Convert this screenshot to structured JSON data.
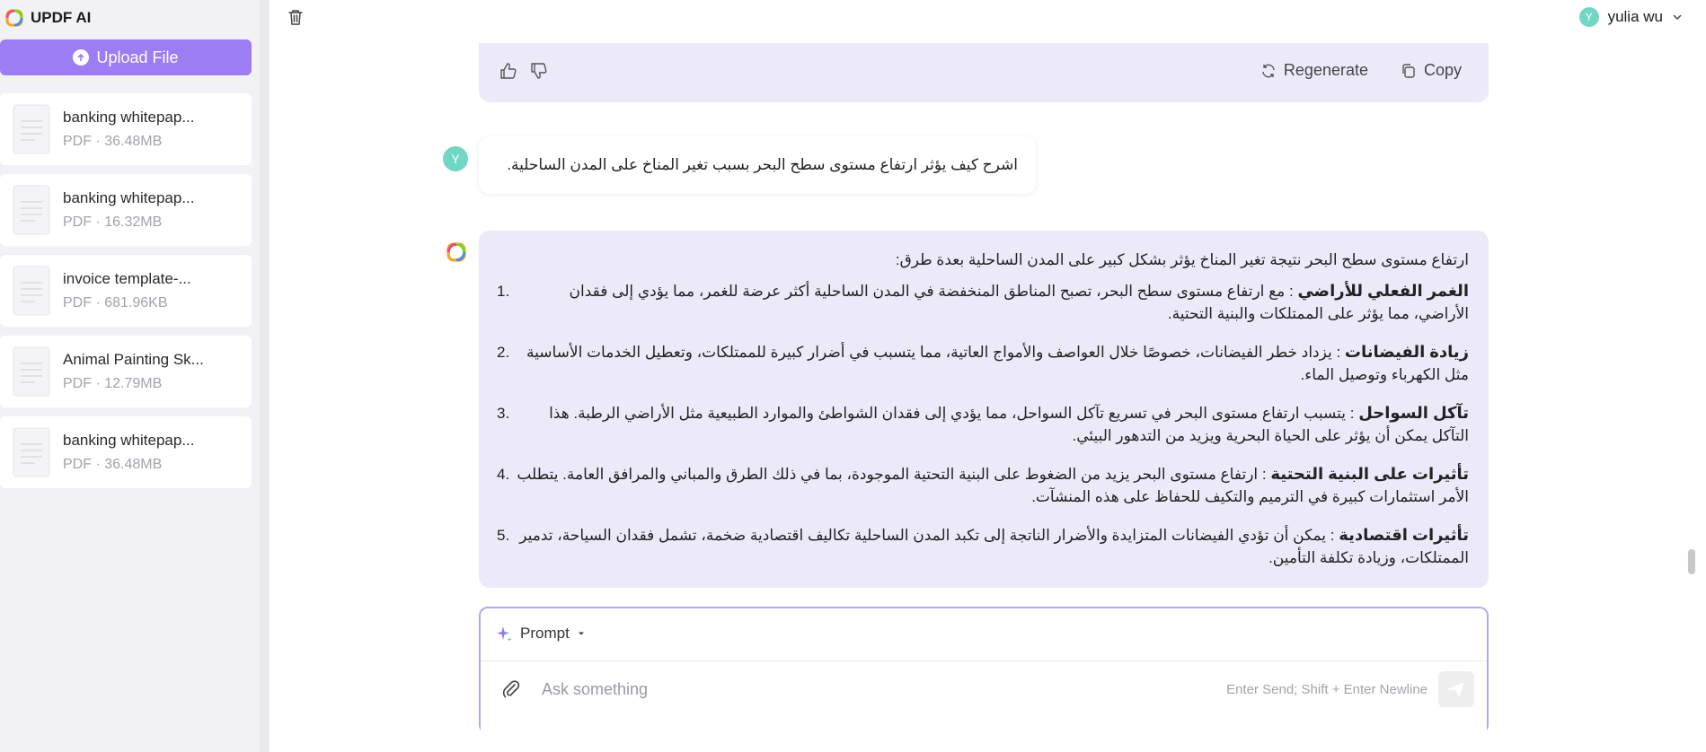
{
  "app": {
    "name": "UPDF AI"
  },
  "sidebar": {
    "upload_label": "Upload File",
    "files": [
      {
        "name": "banking whitepap...",
        "meta": "PDF · 36.48MB"
      },
      {
        "name": "banking whitepap...",
        "meta": "PDF · 16.32MB"
      },
      {
        "name": "invoice template-...",
        "meta": "PDF · 681.96KB"
      },
      {
        "name": "Animal Painting Sk...",
        "meta": "PDF · 12.79MB"
      },
      {
        "name": "banking whitepap...",
        "meta": "PDF · 36.48MB"
      }
    ]
  },
  "header": {
    "user_initial": "Y",
    "user_name": "yulia wu"
  },
  "prev_answer_actions": {
    "regenerate_label": "Regenerate",
    "copy_label": "Copy"
  },
  "chat": {
    "user_avatar_initial": "Y",
    "user_message": "اشرح كيف يؤثر ارتفاع مستوى سطح البحر بسبب تغير المناخ على المدن الساحلية.",
    "ai_intro": "ارتفاع مستوى سطح البحر نتيجة تغير المناخ يؤثر بشكل كبير على المدن الساحلية بعدة طرق:",
    "ai_items": [
      {
        "num": "1.",
        "title": "الغمر الفعلي للأراضي",
        "text": ": مع ارتفاع مستوى سطح البحر، تصبح المناطق المنخفضة في المدن الساحلية أكثر عرضة للغمر، مما يؤدي إلى فقدان الأراضي، مما يؤثر على الممتلكات والبنية التحتية."
      },
      {
        "num": "2.",
        "title": "زيادة الفيضانات",
        "text": ": يزداد خطر الفيضانات، خصوصًا خلال العواصف والأمواج العاتية، مما يتسبب في أضرار كبيرة للممتلكات، وتعطيل الخدمات الأساسية مثل الكهرباء وتوصيل الماء."
      },
      {
        "num": "3.",
        "title": "تآكل السواحل",
        "text": ": يتسبب ارتفاع مستوى البحر في تسريع تآكل السواحل، مما يؤدي إلى فقدان الشواطئ والموارد الطبيعية مثل الأراضي الرطبة. هذا التآكل يمكن أن يؤثر على الحياة البحرية ويزيد من التدهور البيئي."
      },
      {
        "num": "4.",
        "title": "تأثيرات على البنية التحتية",
        "text": ": ارتفاع مستوى البحر يزيد من الضغوط على البنية التحتية الموجودة، بما في ذلك الطرق والمباني والمرافق العامة. يتطلب الأمر استثمارات كبيرة في الترميم والتكيف للحفاظ على هذه المنشآت."
      },
      {
        "num": "5.",
        "title": "تأثيرات اقتصادية",
        "text": ": يمكن أن تؤدي الفيضانات المتزايدة والأضرار الناتجة إلى تكبد المدن الساحلية تكاليف اقتصادية ضخمة، تشمل فقدان السياحة، تدمير الممتلكات، وزيادة تكلفة التأمين."
      }
    ]
  },
  "composer": {
    "prompt_label": "Prompt",
    "placeholder": "Ask something",
    "hint": "Enter Send; Shift + Enter Newline"
  },
  "colors": {
    "accent": "#9c7df3",
    "answer_bg": "#eceaf9",
    "avatar": "#72d6c5"
  }
}
